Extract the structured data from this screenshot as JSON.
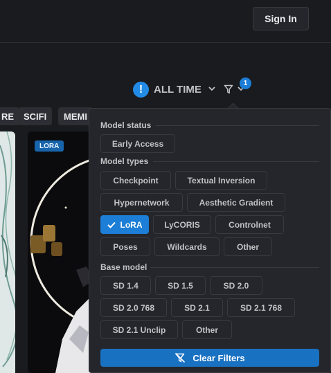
{
  "header": {
    "sign_in_label": "Sign In"
  },
  "sort": {
    "label": "ALL TIME",
    "filter_count": "1",
    "alert_glyph": "!"
  },
  "tags": [
    "RE",
    "SCIFI",
    "MEMI"
  ],
  "card": {
    "badge": "LORA"
  },
  "filters": {
    "model_status": {
      "title": "Model status",
      "options": [
        {
          "label": "Early Access",
          "active": false
        }
      ]
    },
    "model_types": {
      "title": "Model types",
      "options": [
        {
          "label": "Checkpoint",
          "active": false
        },
        {
          "label": "Textual Inversion",
          "active": false
        },
        {
          "label": "Hypernetwork",
          "active": false
        },
        {
          "label": "Aesthetic Gradient",
          "active": false
        },
        {
          "label": "LoRA",
          "active": true
        },
        {
          "label": "LyCORIS",
          "active": false
        },
        {
          "label": "Controlnet",
          "active": false
        },
        {
          "label": "Poses",
          "active": false
        },
        {
          "label": "Wildcards",
          "active": false
        },
        {
          "label": "Other",
          "active": false
        }
      ]
    },
    "base_model": {
      "title": "Base model",
      "options": [
        {
          "label": "SD 1.4",
          "active": false
        },
        {
          "label": "SD 1.5",
          "active": false
        },
        {
          "label": "SD 2.0",
          "active": false
        },
        {
          "label": "SD 2.0 768",
          "active": false
        },
        {
          "label": "SD 2.1",
          "active": false
        },
        {
          "label": "SD 2.1 768",
          "active": false
        },
        {
          "label": "SD 2.1 Unclip",
          "active": false
        },
        {
          "label": "Other",
          "active": false
        }
      ]
    },
    "clear_label": "Clear Filters"
  },
  "colors": {
    "accent": "#1c7ed6",
    "panel": "#25262b",
    "background": "#1a1b1e"
  },
  "icons": {
    "alert": "alert-circle-icon",
    "filter": "filter-icon",
    "check": "check-icon",
    "clear": "filter-off-icon",
    "chevron": "chevron-down-icon"
  }
}
